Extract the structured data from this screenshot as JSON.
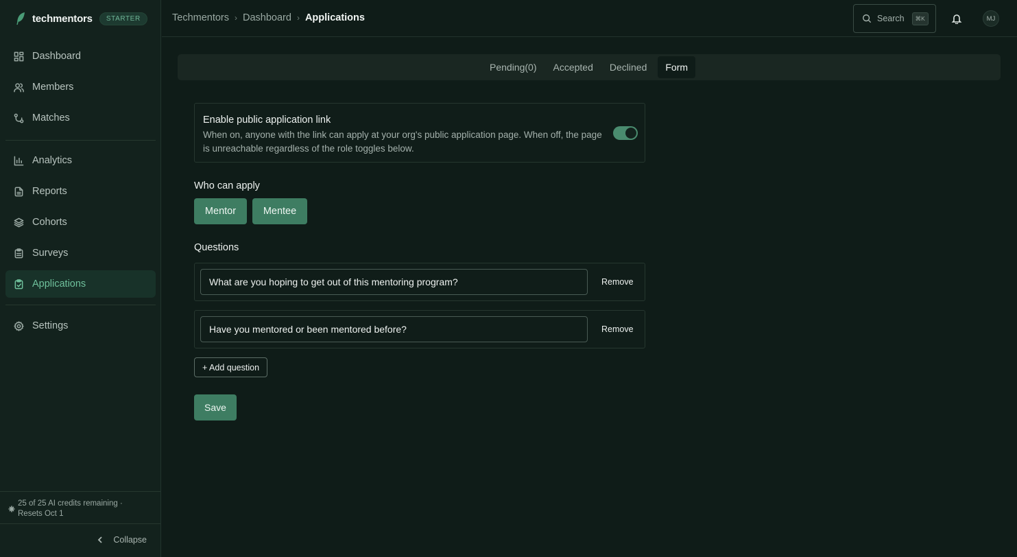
{
  "brand": {
    "name": "techmentors",
    "badge": "STARTER"
  },
  "sidebar": {
    "items": [
      {
        "label": "Dashboard",
        "icon": "dashboard-icon"
      },
      {
        "label": "Members",
        "icon": "users-icon"
      },
      {
        "label": "Matches",
        "icon": "git-merge-icon"
      },
      {
        "label": "Analytics",
        "icon": "bar-chart-icon"
      },
      {
        "label": "Reports",
        "icon": "file-icon"
      },
      {
        "label": "Cohorts",
        "icon": "layers-icon"
      },
      {
        "label": "Surveys",
        "icon": "clipboard-icon"
      },
      {
        "label": "Applications",
        "icon": "clipboard-check-icon",
        "active": true
      },
      {
        "label": "Settings",
        "icon": "gear-icon"
      }
    ],
    "credits": "25 of 25 AI credits remaining · Resets Oct 1",
    "collapse_label": "Collapse"
  },
  "breadcrumb": [
    "Techmentors",
    "Dashboard",
    "Applications"
  ],
  "topbar": {
    "search_label": "Search",
    "search_shortcut": "⌘K",
    "avatar_initials": "MJ"
  },
  "tabs": [
    {
      "label": "Pending(0)"
    },
    {
      "label": "Accepted"
    },
    {
      "label": "Declined"
    },
    {
      "label": "Form",
      "active": true
    }
  ],
  "public_link": {
    "title": "Enable public application link",
    "description": "When on, anyone with the link can apply at your org's public application page. When off, the page is unreachable regardless of the role toggles below.",
    "enabled": true
  },
  "who_can_apply": {
    "label": "Who can apply",
    "roles": [
      "Mentor",
      "Mentee"
    ]
  },
  "questions": {
    "label": "Questions",
    "items": [
      "What are you hoping to get out of this mentoring program?",
      "Have you mentored or been mentored before?"
    ],
    "remove_label": "Remove",
    "add_label": "+ Add question"
  },
  "save_label": "Save",
  "colors": {
    "accent": "#3e7d62",
    "active_text": "#6fc19c",
    "background": "#0f1c18"
  }
}
